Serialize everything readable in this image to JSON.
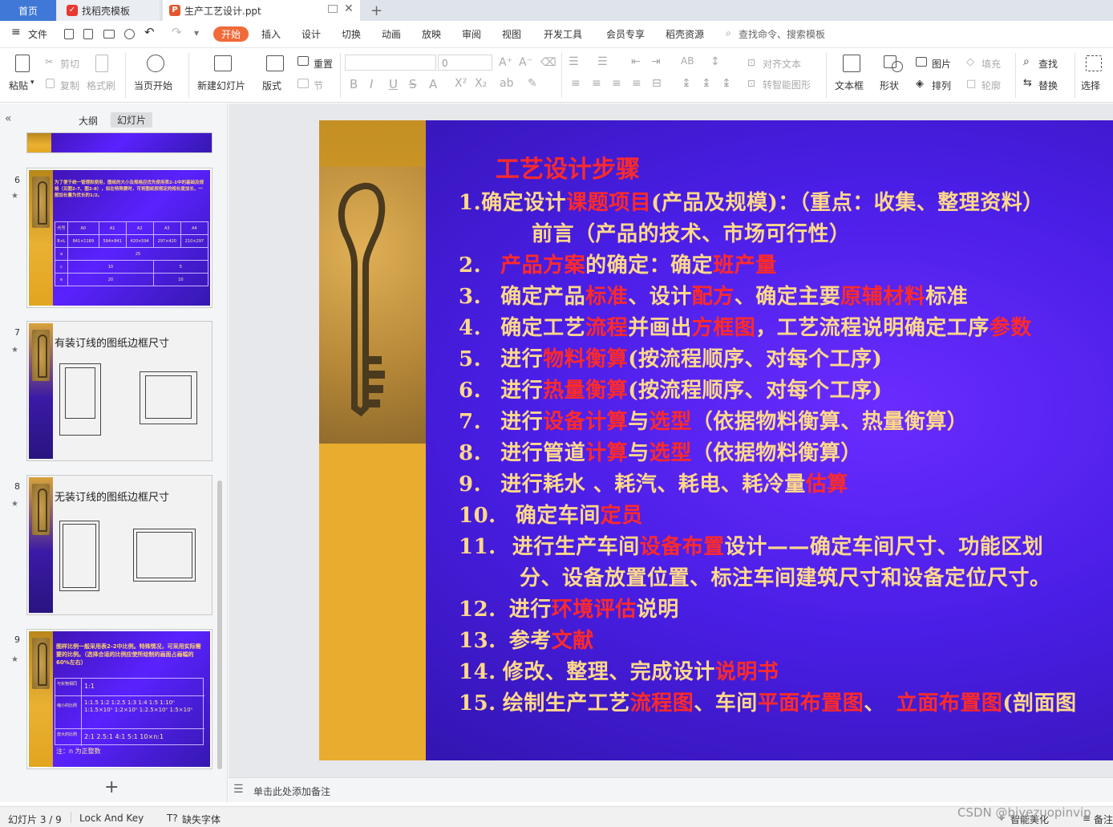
{
  "tabs": {
    "home": "首页",
    "template": "找稻壳模板",
    "document": "生产工艺设计.ppt",
    "add": "+"
  },
  "menu": {
    "file": "文件",
    "items": [
      "开始",
      "插入",
      "设计",
      "切换",
      "动画",
      "放映",
      "审阅",
      "视图",
      "开发工具",
      "会员专享",
      "稻壳资源"
    ],
    "search": "查找命令、搜索模板"
  },
  "toolbar": {
    "paste": "粘贴",
    "cut": "剪切",
    "copy": "复制",
    "format_painter": "格式刷",
    "play_from_current": "当页开始",
    "new_slide": "新建幻灯片",
    "layout": "版式",
    "section": "节",
    "reset": "重置",
    "font_size": "0",
    "align_text": "对齐文本",
    "smart_shape": "转智能图形",
    "textbox": "文本框",
    "shape": "形状",
    "picture": "图片",
    "arrange": "排列",
    "fill": "填充",
    "outline": "轮廓",
    "find": "查找",
    "replace": "替换",
    "select": "选择"
  },
  "pane": {
    "outline_tab": "大纲",
    "slides_tab": "幻灯片",
    "add_slide": "+"
  },
  "thumbs": {
    "s6_num": "6",
    "s6_text": "为了便于统一管理和使用，图纸的大小及规格应优先使用表2-1中的基础及规格（见图2-7、图2-8），如在特殊要时，可将图纸按规定的相长度加长，一般加长量为优长的1/2。",
    "s6_headers": [
      "代号",
      "A0",
      "A1",
      "A2",
      "A3",
      "A4"
    ],
    "s6_row1": [
      "B×L",
      "841×1189",
      "594×841",
      "420×594",
      "297×420",
      "210×297"
    ],
    "s6_row2": [
      "a",
      "25"
    ],
    "s6_row3": [
      "c",
      "10",
      "5"
    ],
    "s6_row4": [
      "e",
      "20",
      "10"
    ],
    "s7_num": "7",
    "s7_title": "有装订线的图纸边框尺寸",
    "s8_num": "8",
    "s8_title": "无装订线的图纸边框尺寸",
    "s9_num": "9",
    "s9_text": "图样比例一般采用表2-2中比例。特殊情况，可采用实际需要的比例。（选择合适的比例应使所绘制的画面占画幅的60%左右）",
    "s9_row1_label": "与实物相同",
    "s9_row1_val": "1:1",
    "s9_row2_label": "缩小的比例",
    "s9_row2_val": "1:1.5 1:2 1:2.5 1:3 1:4 1:5 1:10ⁿ 1:1.5×10ⁿ 1:2×10ⁿ 1:2.5×10ⁿ 1:5×10ⁿ",
    "s9_row3_label": "放大的比例",
    "s9_row3_val": "2:1 2.5:1 4:1 5:1 10×n:1",
    "s9_note": "注：n 为正整数"
  },
  "slide": {
    "title": "工艺设计步骤",
    "l1a": "1.确定设计",
    "l1b": "课题项目",
    "l1c": "(产品及规模)：（重点：收集、整理资料）",
    "l1d": "前言（产品的技术、市场可行性）",
    "l2a": "2.",
    "l2b": "产品方案",
    "l2c": "的确定：确定",
    "l2d": "班产量",
    "l3a": "3.",
    "l3b": "确定产品",
    "l3c": "标准",
    "l3d": "、设计",
    "l3e": "配方",
    "l3f": "、确定主要",
    "l3g": "原辅材料",
    "l3h": "标准",
    "l4a": "4.",
    "l4b": "确定工艺",
    "l4c": "流程",
    "l4d": "并画出",
    "l4e": "方框图",
    "l4f": "，工艺流程说明确定工序",
    "l4g": "参数",
    "l5a": "5.",
    "l5b": "进行",
    "l5c": "物料衡算",
    "l5d": "(按流程顺序、对每个工序)",
    "l6a": "6.",
    "l6b": "进行",
    "l6c": "热量衡算",
    "l6d": "(按流程顺序、对每个工序)",
    "l7a": "7.",
    "l7b": "进行",
    "l7c": "设备计算",
    "l7d": "与",
    "l7e": "选型",
    "l7f": "（依据物料衡算、热量衡算）",
    "l8a": "8.",
    "l8b": "进行管道",
    "l8c": "计算",
    "l8d": "与",
    "l8e": "选型",
    "l8f": "（依据物料衡算）",
    "l9a": "9.",
    "l9b": "进行耗水 、耗汽、耗电、耗冷量",
    "l9c": "估算",
    "l10a": "10.",
    "l10b": "确定车间",
    "l10c": "定员",
    "l11a": "11.",
    "l11b": "进行生产车间",
    "l11c": "设备布置",
    "l11d": "设计——确定车间尺寸、功能区划",
    "l11e": "分、设备放置位置、标注车间建筑尺寸和设备定位尺寸。",
    "l12a": "12.",
    "l12b": "进行",
    "l12c": "环境评估",
    "l12d": "说明",
    "l13a": "13.",
    "l13b": "参考",
    "l13c": "文献",
    "l14a": "14.",
    "l14b": "修改、整理、完成设计",
    "l14c": "说明书",
    "l15a": "15.",
    "l15b": "绘制生产工艺",
    "l15c": "流程图",
    "l15d": "、车间",
    "l15e": "平面布置图",
    "l15f": "、",
    "l15g": "立面布置图",
    "l15h": "(剖面图"
  },
  "notes": {
    "placeholder": "单击此处添加备注"
  },
  "status": {
    "slide_pos": "幻灯片 3 / 9",
    "theme": "Lock And Key",
    "missing_font": "缺失字体",
    "smart": "智能美化",
    "notes_btn": "备注",
    "watermark": "CSDN @biyezuopinvip"
  }
}
